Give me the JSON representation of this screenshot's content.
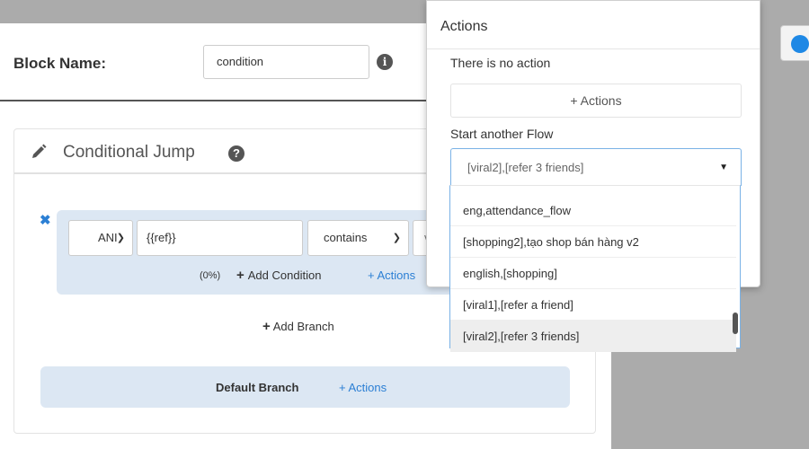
{
  "block": {
    "label": "Block Name:",
    "value": "condition"
  },
  "conditional_jump": {
    "title": "Conditional Jump",
    "condition": {
      "logic_selected": "ANI",
      "variable": "{{ref}}",
      "operator_selected": "contains",
      "value_partial": "v",
      "percent": "(0%)",
      "add_condition_label": "Add Condition",
      "actions_label": "+ Actions"
    },
    "add_branch_label": "Add Branch",
    "default_branch": {
      "label": "Default Branch",
      "actions_label": "+ Actions"
    }
  },
  "actions_popover": {
    "title": "Actions",
    "no_action_text": "There is no action",
    "add_actions_label": "+ Actions",
    "start_flow_label": "Start another Flow",
    "selected_flow": "[viral2],[refer 3 friends]",
    "flow_options": [
      "eng,attendance_flow",
      "[shopping2],tạo shop bán hàng v2",
      "english,[shopping]",
      "[viral1],[refer a friend]",
      "[viral2],[refer 3 friends]"
    ]
  },
  "colors": {
    "accent": "#2b7fd4",
    "branch_bg": "#dce7f3",
    "backdrop": "#ababab"
  }
}
